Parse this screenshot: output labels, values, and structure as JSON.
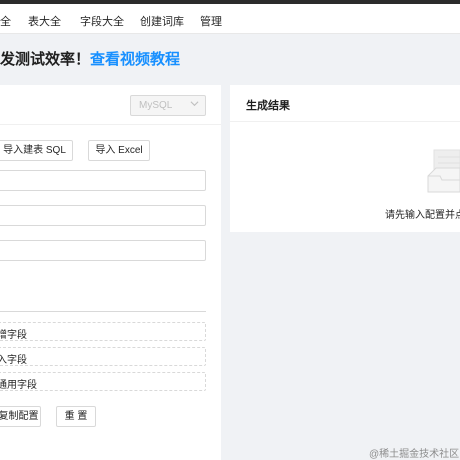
{
  "nav": {
    "items": [
      {
        "label": "全"
      },
      {
        "label": "表大全"
      },
      {
        "label": "字段大全"
      },
      {
        "label": "创建词库"
      },
      {
        "label": "管理"
      }
    ]
  },
  "banner": {
    "text": "发测试效率！",
    "link": "查看视频教程"
  },
  "db_select": {
    "value": "MySQL"
  },
  "import_buttons": {
    "sql": "导入建表 SQL",
    "excel": "导入 Excel"
  },
  "field_actions": {
    "add": "增字段",
    "import": "入字段",
    "common": "通用字段"
  },
  "bottom_buttons": {
    "copy_config": "复制配置",
    "reset": "重 置"
  },
  "result": {
    "title": "生成结果",
    "empty_text": "请先输入配置并点击"
  },
  "watermark": "@稀土掘金技术社区"
}
